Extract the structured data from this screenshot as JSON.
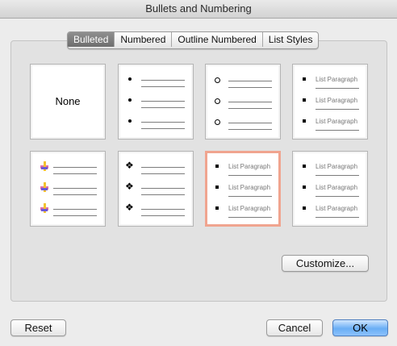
{
  "window": {
    "title": "Bullets and Numbering"
  },
  "tabs": [
    {
      "label": "Bulleted",
      "selected": true
    },
    {
      "label": "Numbered",
      "selected": false
    },
    {
      "label": "Outline Numbered",
      "selected": false
    },
    {
      "label": "List Styles",
      "selected": false
    }
  ],
  "styles": {
    "none_label": "None",
    "list_paragraph_text": "List Paragraph",
    "selected_style_index": 6,
    "items": [
      {
        "name": "none"
      },
      {
        "name": "solid-dot",
        "bullet_icon": "small-solid-dot"
      },
      {
        "name": "hollow-circle",
        "bullet_icon": "hollow-circle"
      },
      {
        "name": "square-list-paragraph",
        "bullet_icon": "small-square"
      },
      {
        "name": "picture-pin",
        "bullet_icon": "colored-pin"
      },
      {
        "name": "diamond",
        "bullet_icon": "four-diamond"
      },
      {
        "name": "square-list-paragraph-selected",
        "bullet_icon": "small-square"
      },
      {
        "name": "square-list-paragraph-2",
        "bullet_icon": "small-square"
      }
    ]
  },
  "buttons": {
    "customize": "Customize...",
    "reset": "Reset",
    "cancel": "Cancel",
    "ok": "OK"
  },
  "colors": {
    "selection_border": "#f0a48f",
    "default_button": "#6aaef5"
  }
}
